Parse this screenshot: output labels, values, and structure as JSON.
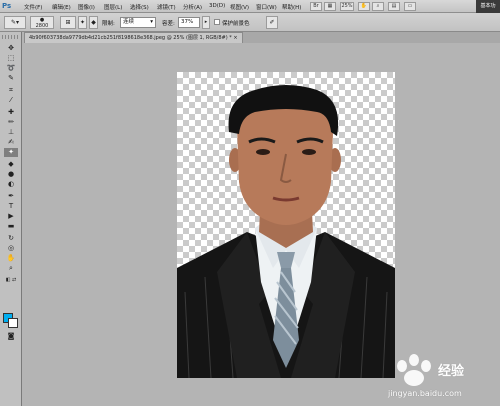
{
  "app": {
    "logo": "Ps",
    "workspace": "基本功"
  },
  "menu": [
    {
      "id": "file",
      "label": "文件(F)"
    },
    {
      "id": "edit",
      "label": "编辑(E)"
    },
    {
      "id": "image",
      "label": "图像(I)"
    },
    {
      "id": "layer",
      "label": "图层(L)"
    },
    {
      "id": "select",
      "label": "选择(S)"
    },
    {
      "id": "filter",
      "label": "滤镜(T)"
    },
    {
      "id": "analysis",
      "label": "分析(A)"
    },
    {
      "id": "3d",
      "label": "3D(D)"
    },
    {
      "id": "view",
      "label": "视图(V)"
    },
    {
      "id": "window",
      "label": "窗口(W)"
    },
    {
      "id": "help",
      "label": "帮助(H)"
    }
  ],
  "menubar_extra": {
    "zoom": "25%"
  },
  "options": {
    "brush_size": "2800",
    "limits_label": "限制:",
    "limits_value": "连续",
    "tolerance_label": "容差:",
    "tolerance_value": "37%",
    "protect_label": "保护前景色"
  },
  "document_tab": {
    "title": "4b90f603738da9779db4d21cb251f8198618e368.jpeg @ 25% (图层 1, RGB/8#) *"
  },
  "watermark": {
    "brand": "经验",
    "url": "jingyan.baidu.com"
  },
  "colors": {
    "foreground": "#00aef0",
    "background": "#ffffff"
  },
  "tools": [
    "move-tool",
    "marquee-tool",
    "lasso-tool",
    "quick-selection-tool",
    "crop-tool",
    "eyedropper-tool",
    "healing-brush-tool",
    "brush-tool",
    "clone-stamp-tool",
    "history-brush-tool",
    "background-eraser-tool",
    "paint-bucket-tool",
    "blur-tool",
    "dodge-tool",
    "pen-tool",
    "type-tool",
    "path-selection-tool",
    "rectangle-tool",
    "3d-rotate-tool",
    "3d-orbit-tool",
    "hand-tool",
    "zoom-tool"
  ]
}
